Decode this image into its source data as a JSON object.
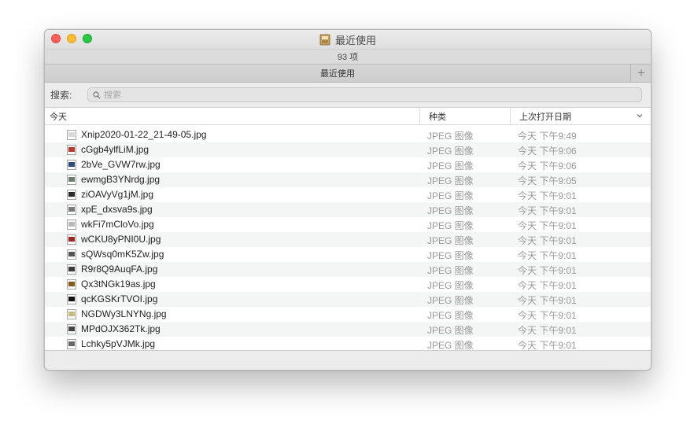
{
  "window": {
    "title": "最近使用",
    "item_count": "93 项",
    "tab_label": "最近使用",
    "tab_add": "+"
  },
  "search": {
    "label": "搜索:",
    "placeholder": "搜索"
  },
  "columns": {
    "name": "今天",
    "kind": "种类",
    "date": "上次打开日期"
  },
  "files": [
    {
      "name": "Xnip2020-01-22_21-49-05.jpg",
      "kind": "JPEG 图像",
      "date": "今天 下午9:49",
      "thumb": "#d8d8d8"
    },
    {
      "name": "cGgb4ylfLiM.jpg",
      "kind": "JPEG 图像",
      "date": "今天 下午9:06",
      "thumb": "#c0392b"
    },
    {
      "name": "2bVe_GVW7rw.jpg",
      "kind": "JPEG 图像",
      "date": "今天 下午9:06",
      "thumb": "#2c4a7a"
    },
    {
      "name": "ewmgB3YNrdg.jpg",
      "kind": "JPEG 图像",
      "date": "今天 下午9:05",
      "thumb": "#6b7b6e"
    },
    {
      "name": "ziOAVyVg1jM.jpg",
      "kind": "JPEG 图像",
      "date": "今天 下午9:01",
      "thumb": "#2a2a2a"
    },
    {
      "name": "xpE_dxsva9s.jpg",
      "kind": "JPEG 图像",
      "date": "今天 下午9:01",
      "thumb": "#7a7a7a"
    },
    {
      "name": "wkFi7mCloVo.jpg",
      "kind": "JPEG 图像",
      "date": "今天 下午9:01",
      "thumb": "#b9b9b9"
    },
    {
      "name": "wCKU8yPNI0U.jpg",
      "kind": "JPEG 图像",
      "date": "今天 下午9:01",
      "thumb": "#a8221f"
    },
    {
      "name": "sQWsq0mK5Zw.jpg",
      "kind": "JPEG 图像",
      "date": "今天 下午9:01",
      "thumb": "#555555"
    },
    {
      "name": "R9r8Q9AuqFA.jpg",
      "kind": "JPEG 图像",
      "date": "今天 下午9:01",
      "thumb": "#3a3a3a"
    },
    {
      "name": "Qx3tNGk19as.jpg",
      "kind": "JPEG 图像",
      "date": "今天 下午9:01",
      "thumb": "#8a5a1a"
    },
    {
      "name": "qcKGSKrTVOI.jpg",
      "kind": "JPEG 图像",
      "date": "今天 下午9:01",
      "thumb": "#111111"
    },
    {
      "name": "NGDWy3LNYNg.jpg",
      "kind": "JPEG 图像",
      "date": "今天 下午9:01",
      "thumb": "#c9b97a"
    },
    {
      "name": "MPdOJX362Tk.jpg",
      "kind": "JPEG 图像",
      "date": "今天 下午9:01",
      "thumb": "#444444"
    },
    {
      "name": "Lchky5pVJMk.jpg",
      "kind": "JPEG 图像",
      "date": "今天 下午9:01",
      "thumb": "#666666"
    }
  ]
}
